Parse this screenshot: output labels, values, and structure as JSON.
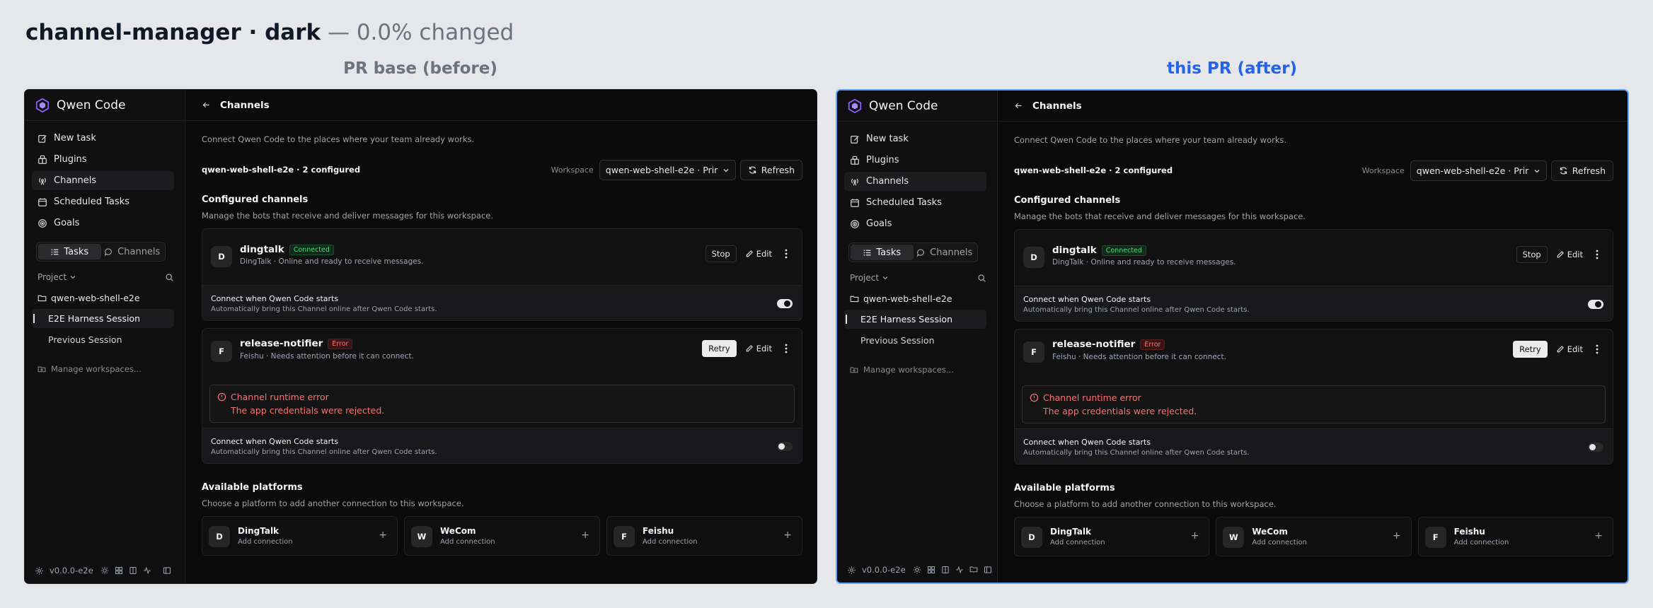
{
  "page": {
    "title": "channel-manager · dark",
    "subtitle": " — 0.0% changed",
    "before_label": "PR base (before)",
    "after_label": "this PR (after)"
  },
  "app": {
    "brand": "Qwen Code",
    "nav": [
      "New task",
      "Plugins",
      "Channels",
      "Scheduled Tasks",
      "Goals"
    ],
    "tabs": [
      "Tasks",
      "Channels"
    ],
    "project_label": "Project",
    "workspace": "qwen-web-shell-e2e",
    "sessions": [
      "E2E Harness Session",
      "Previous Session"
    ],
    "manage": "Manage workspaces...",
    "version": "v0.0.0-e2e"
  },
  "main": {
    "back": "←",
    "title": "Channels",
    "intro": "Connect Qwen Code to the places where your team already works.",
    "summary": "qwen-web-shell-e2e · 2 configured",
    "workspace_label": "Workspace",
    "workspace_value": "qwen-web-shell-e2e · Prir",
    "refresh": "Refresh",
    "configured_title": "Configured channels",
    "configured_desc": "Manage the bots that receive and deliver messages for this workspace.",
    "channels": [
      {
        "letter": "D",
        "name": "dingtalk",
        "status": "Connected",
        "desc": "DingTalk · Online and ready to receive messages.",
        "primary": "Stop",
        "edit": "Edit",
        "opt_title": "Connect when Qwen Code starts",
        "opt_desc": "Automatically bring this Channel online after Qwen Code starts."
      },
      {
        "letter": "F",
        "name": "release-notifier",
        "status": "Error",
        "desc": "Feishu · Needs attention before it can connect.",
        "primary": "Retry",
        "edit": "Edit",
        "error_title": "Channel runtime error",
        "error_msg": "The app credentials were rejected.",
        "opt_title": "Connect when Qwen Code starts",
        "opt_desc": "Automatically bring this Channel online after Qwen Code starts."
      }
    ],
    "available_title": "Available platforms",
    "available_desc": "Choose a platform to add another connection to this workspace.",
    "platforms": [
      {
        "letter": "D",
        "name": "DingTalk",
        "sub": "Add connection",
        "add": "+"
      },
      {
        "letter": "W",
        "name": "WeCom",
        "sub": "Add connection",
        "add": "+"
      },
      {
        "letter": "F",
        "name": "Feishu",
        "sub": "Add connection",
        "add": "+"
      }
    ]
  },
  "toggles": {
    "dingtalk_autostart": true,
    "release_notifier_autostart": false
  },
  "colors": {
    "accent_after": "#2563eb",
    "connected": "#4ade80",
    "error": "#f87171",
    "frame_bg": "#0a0a0a"
  }
}
